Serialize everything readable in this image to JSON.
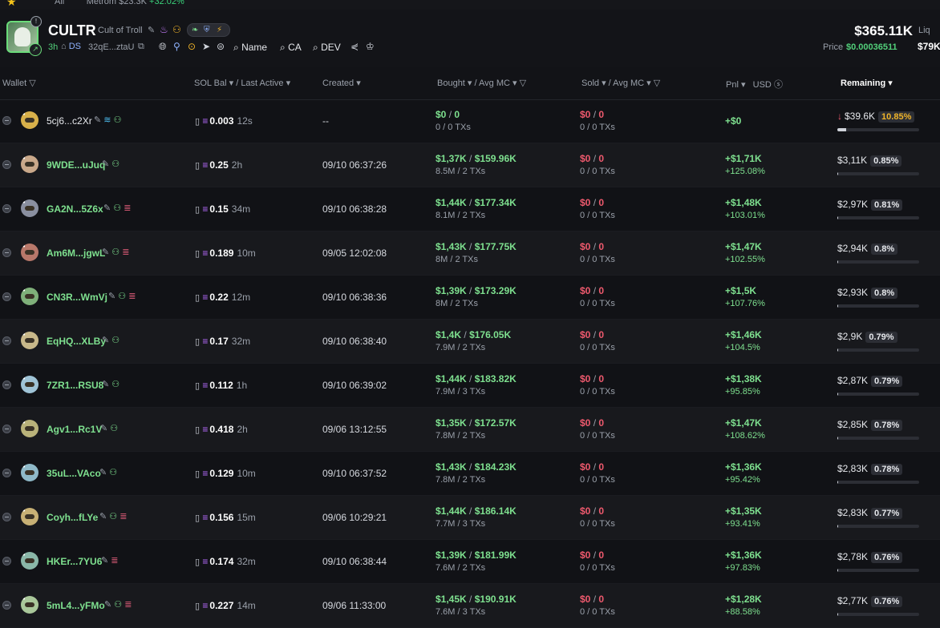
{
  "topstrip": {
    "tab_text": "All",
    "ticker_text": "Metrom $23.3K",
    "ticker_change": "+32.02%"
  },
  "token": {
    "symbol": "CULTR",
    "name": "Cult of Troll",
    "age": "3h",
    "ds_label": "DS",
    "address": "32qE...ztaU",
    "search_name": "Name",
    "search_ca": "CA",
    "search_dev": "DEV",
    "market_cap": "$365.11K",
    "price_label": "Price",
    "price_value": "$0.00036511",
    "liq_label": "Liq",
    "liq_value": "$79K"
  },
  "columns": {
    "wallet": "Wallet",
    "sol_bal": "SOL Bal",
    "last_active": "/ Last Active",
    "created": "Created",
    "bought": "Bought",
    "avg_mc_b": "/ Avg MC",
    "sold": "Sold",
    "avg_mc_s": "/ Avg MC",
    "pnl": "Pnl",
    "usd": "USD",
    "remaining": "Remaining"
  },
  "rows": [
    {
      "wallet": "5cj6...c2Xr",
      "sol": "0.003",
      "ago": "12s",
      "created": "--",
      "bought_usd": "$0",
      "bought_mc": "0",
      "bought_sub": "0 / 0 TXs",
      "sold_usd": "$0",
      "sold_mc": "0",
      "sold_sub": "0 / 0 TXs",
      "pnl_usd": "+$0",
      "pnl_pct": "",
      "remaining": "$39.6K",
      "rem_pct": "10.85%",
      "rem_frac": 0.1085
    },
    {
      "wallet": "9WDE...uJuq",
      "sol": "0.25",
      "ago": "2h",
      "created": "09/10 06:37:26",
      "bought_usd": "$1,37K",
      "bought_mc": "$159.96K",
      "bought_sub": "8.5M / 2 TXs",
      "sold_usd": "$0",
      "sold_mc": "0",
      "sold_sub": "0 / 0 TXs",
      "pnl_usd": "+$1,71K",
      "pnl_pct": "+125.08%",
      "remaining": "$3,11K",
      "rem_pct": "0.85%",
      "rem_frac": 0.0085
    },
    {
      "wallet": "GA2N...5Z6x",
      "sol": "0.15",
      "ago": "34m",
      "created": "09/10 06:38:28",
      "bought_usd": "$1,44K",
      "bought_mc": "$177.34K",
      "bought_sub": "8.1M / 2 TXs",
      "sold_usd": "$0",
      "sold_mc": "0",
      "sold_sub": "0 / 0 TXs",
      "pnl_usd": "+$1,48K",
      "pnl_pct": "+103.01%",
      "remaining": "$2,97K",
      "rem_pct": "0.81%",
      "rem_frac": 0.0081
    },
    {
      "wallet": "Am6M...jgwL",
      "sol": "0.189",
      "ago": "10m",
      "created": "09/05 12:02:08",
      "bought_usd": "$1,43K",
      "bought_mc": "$177.75K",
      "bought_sub": "8M / 2 TXs",
      "sold_usd": "$0",
      "sold_mc": "0",
      "sold_sub": "0 / 0 TXs",
      "pnl_usd": "+$1,47K",
      "pnl_pct": "+102.55%",
      "remaining": "$2,94K",
      "rem_pct": "0.8%",
      "rem_frac": 0.008
    },
    {
      "wallet": "CN3R...WmVj",
      "sol": "0.22",
      "ago": "12m",
      "created": "09/10 06:38:36",
      "bought_usd": "$1,39K",
      "bought_mc": "$173.29K",
      "bought_sub": "8M / 2 TXs",
      "sold_usd": "$0",
      "sold_mc": "0",
      "sold_sub": "0 / 0 TXs",
      "pnl_usd": "+$1,5K",
      "pnl_pct": "+107.76%",
      "remaining": "$2,93K",
      "rem_pct": "0.8%",
      "rem_frac": 0.008
    },
    {
      "wallet": "EqHQ...XLBy",
      "sol": "0.17",
      "ago": "32m",
      "created": "09/10 06:38:40",
      "bought_usd": "$1,4K",
      "bought_mc": "$176.05K",
      "bought_sub": "7.9M / 2 TXs",
      "sold_usd": "$0",
      "sold_mc": "0",
      "sold_sub": "0 / 0 TXs",
      "pnl_usd": "+$1,46K",
      "pnl_pct": "+104.5%",
      "remaining": "$2,9K",
      "rem_pct": "0.79%",
      "rem_frac": 0.0079
    },
    {
      "wallet": "7ZR1...RSU8",
      "sol": "0.112",
      "ago": "1h",
      "created": "09/10 06:39:02",
      "bought_usd": "$1,44K",
      "bought_mc": "$183.82K",
      "bought_sub": "7.9M / 3 TXs",
      "sold_usd": "$0",
      "sold_mc": "0",
      "sold_sub": "0 / 0 TXs",
      "pnl_usd": "+$1,38K",
      "pnl_pct": "+95.85%",
      "remaining": "$2,87K",
      "rem_pct": "0.79%",
      "rem_frac": 0.0079
    },
    {
      "wallet": "Agv1...Rc1V",
      "sol": "0.418",
      "ago": "2h",
      "created": "09/06 13:12:55",
      "bought_usd": "$1,35K",
      "bought_mc": "$172.57K",
      "bought_sub": "7.8M / 2 TXs",
      "sold_usd": "$0",
      "sold_mc": "0",
      "sold_sub": "0 / 0 TXs",
      "pnl_usd": "+$1,47K",
      "pnl_pct": "+108.62%",
      "remaining": "$2,85K",
      "rem_pct": "0.78%",
      "rem_frac": 0.0078
    },
    {
      "wallet": "35uL...VAco",
      "sol": "0.129",
      "ago": "10m",
      "created": "09/10 06:37:52",
      "bought_usd": "$1,43K",
      "bought_mc": "$184.23K",
      "bought_sub": "7.8M / 2 TXs",
      "sold_usd": "$0",
      "sold_mc": "0",
      "sold_sub": "0 / 0 TXs",
      "pnl_usd": "+$1,36K",
      "pnl_pct": "+95.42%",
      "remaining": "$2,83K",
      "rem_pct": "0.78%",
      "rem_frac": 0.0078
    },
    {
      "wallet": "Coyh...fLYe",
      "sol": "0.156",
      "ago": "15m",
      "created": "09/06 10:29:21",
      "bought_usd": "$1,44K",
      "bought_mc": "$186.14K",
      "bought_sub": "7.7M / 3 TXs",
      "sold_usd": "$0",
      "sold_mc": "0",
      "sold_sub": "0 / 0 TXs",
      "pnl_usd": "+$1,35K",
      "pnl_pct": "+93.41%",
      "remaining": "$2,83K",
      "rem_pct": "0.77%",
      "rem_frac": 0.0077
    },
    {
      "wallet": "HKEr...7YU6",
      "sol": "0.174",
      "ago": "32m",
      "created": "09/10 06:38:44",
      "bought_usd": "$1,39K",
      "bought_mc": "$181.99K",
      "bought_sub": "7.6M / 2 TXs",
      "sold_usd": "$0",
      "sold_mc": "0",
      "sold_sub": "0 / 0 TXs",
      "pnl_usd": "+$1,36K",
      "pnl_pct": "+97.83%",
      "remaining": "$2,78K",
      "rem_pct": "0.76%",
      "rem_frac": 0.0076
    },
    {
      "wallet": "5mL4...yFMo",
      "sol": "0.227",
      "ago": "14m",
      "created": "09/06 11:33:00",
      "bought_usd": "$1,45K",
      "bought_mc": "$190.91K",
      "bought_sub": "7.6M / 3 TXs",
      "sold_usd": "$0",
      "sold_mc": "0",
      "sold_sub": "0 / 0 TXs",
      "pnl_usd": "+$1,28K",
      "pnl_pct": "+88.58%",
      "remaining": "$2,77K",
      "rem_pct": "0.76%",
      "rem_frac": 0.0076
    }
  ],
  "colors": {
    "accent_green": "#7ee08f",
    "accent_red": "#f05a6e",
    "warn": "#f0b429",
    "bg": "#111216"
  }
}
